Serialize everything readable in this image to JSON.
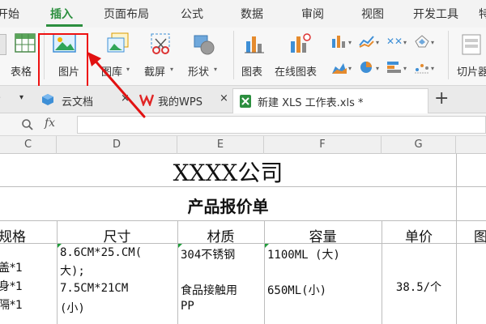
{
  "menu": {
    "tabs": [
      "开始",
      "插入",
      "页面布局",
      "公式",
      "数据",
      "审阅",
      "视图",
      "开发工具",
      "特"
    ],
    "active_index": 1
  },
  "ribbon": {
    "labels": {
      "table": "表格",
      "picture": "图片",
      "gallery": "图库",
      "screenshot": "截屏",
      "shapes": "形状",
      "chart": "图表",
      "online_chart": "在线图表",
      "clipart": "切片器"
    },
    "dropdown_glyph": "▾"
  },
  "doc_tabs": {
    "tabs": [
      {
        "label": "云文档",
        "closable": true
      },
      {
        "label": "我的WPS",
        "closable": true
      },
      {
        "label": "新建 XLS 工作表.xls *",
        "closable": false,
        "active": true
      }
    ],
    "new_tab": "+"
  },
  "formula_bar": {
    "fx": "fx",
    "value": ""
  },
  "columns": [
    "C",
    "D",
    "E",
    "F",
    "G",
    ""
  ],
  "sheet": {
    "company": "XXXX公司",
    "doc_title": "产品报价单",
    "headers": [
      "规格",
      "尺寸",
      "材质",
      "容量",
      "单价",
      "图"
    ],
    "row": {
      "spec": [
        "盖*1",
        "身*1",
        "隔*1"
      ],
      "size": [
        "8.6CM*25.CM(",
        "大);",
        "7.5CM*21CM",
        "(小)"
      ],
      "material": [
        "304不锈钢",
        "",
        "食品接触用",
        "PP"
      ],
      "capacity": [
        "1100ML (大)",
        "650ML(小)"
      ],
      "price": "38.5/个"
    }
  },
  "colors": {
    "accent_green": "#2c8f3f",
    "annotation_red": "#e11111"
  }
}
